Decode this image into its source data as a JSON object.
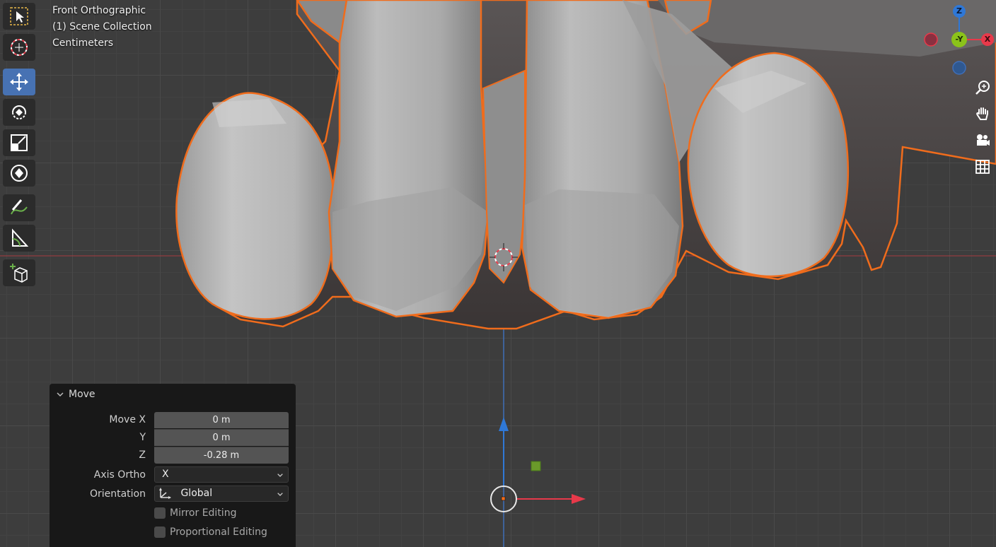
{
  "viewport": {
    "view_name": "Front Orthographic",
    "collection": "(1) Scene Collection",
    "units": "Centimeters"
  },
  "gizmo": {
    "z_label": "Z",
    "y_label": "-Y",
    "x_label": "X"
  },
  "toolbar": {
    "tools": [
      "select-box",
      "cursor",
      "move",
      "rotate",
      "scale",
      "transform",
      "annotate",
      "measure",
      "add-cube"
    ],
    "active": "move"
  },
  "nav": {
    "buttons": [
      "zoom",
      "pan",
      "camera",
      "ortho-grid"
    ]
  },
  "operator_panel": {
    "title": "Move",
    "move_x_label": "Move X",
    "move_x_value": "0 m",
    "y_label": "Y",
    "y_value": "0 m",
    "z_label": "Z",
    "z_value": "-0.28 m",
    "axis_ortho_label": "Axis Ortho",
    "axis_ortho_value": "X",
    "orientation_label": "Orientation",
    "orientation_value": "Global",
    "mirror_label": "Mirror Editing",
    "proportional_label": "Proportional Editing"
  },
  "colors": {
    "selection_outline": "#f06c1c",
    "active_tool": "#4772b3",
    "x_axis": "#e8394a",
    "y_axis": "#8bc31a",
    "z_axis": "#2f78d6"
  }
}
